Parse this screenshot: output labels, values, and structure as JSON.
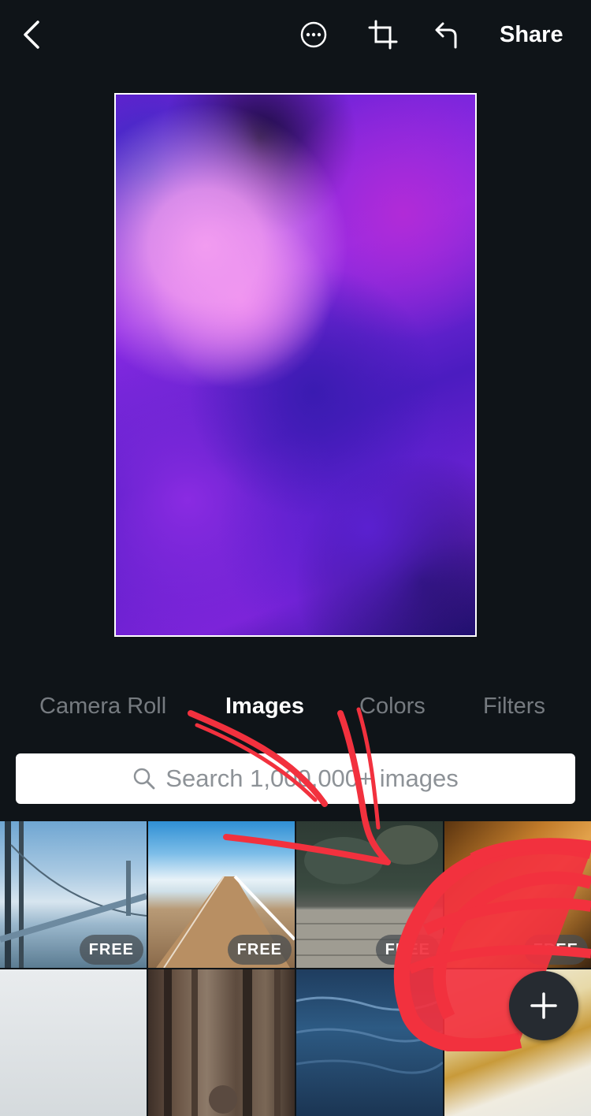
{
  "toolbar": {
    "back_icon": "chevron-left-icon",
    "more_icon": "more-options-icon",
    "crop_icon": "crop-icon",
    "undo_icon": "undo-icon",
    "share_label": "Share"
  },
  "tabs": [
    {
      "label": "Camera Roll",
      "active": false
    },
    {
      "label": "Images",
      "active": true
    },
    {
      "label": "Colors",
      "active": false
    },
    {
      "label": "Filters",
      "active": false
    }
  ],
  "search": {
    "placeholder": "Search 1,000,000+ images",
    "icon": "search-icon"
  },
  "images": [
    {
      "subject": "bridge in fog",
      "badge": "FREE"
    },
    {
      "subject": "pier over sea",
      "badge": "FREE"
    },
    {
      "subject": "dark rocks and wood",
      "badge": "FREE"
    },
    {
      "subject": "autumn forest",
      "badge": "FREE"
    },
    {
      "subject": "misty landscape",
      "badge": ""
    },
    {
      "subject": "forest trees",
      "badge": ""
    },
    {
      "subject": "ocean water",
      "badge": ""
    },
    {
      "subject": "golden leaves",
      "badge": ""
    }
  ],
  "fab": {
    "icon": "plus-icon"
  },
  "colors": {
    "background": "#0f1418",
    "annotation": "#f2313e",
    "inactive_tab": "#767b80"
  }
}
